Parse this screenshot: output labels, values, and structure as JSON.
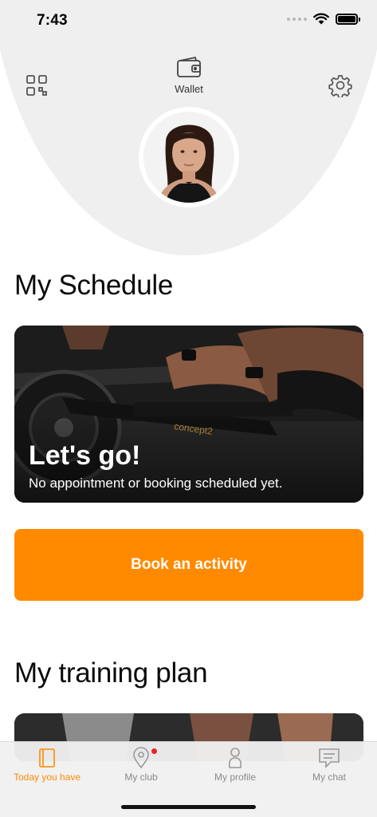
{
  "status_bar": {
    "time": "7:43"
  },
  "header": {
    "wallet_label": "Wallet"
  },
  "schedule": {
    "title": "My Schedule",
    "card_heading": "Let's go!",
    "card_text": "No appointment or booking scheduled yet."
  },
  "book_button": {
    "label": "Book an activity"
  },
  "training": {
    "title": "My training plan"
  },
  "tabs": [
    {
      "label": "Today you have",
      "active": true
    },
    {
      "label": "My club",
      "active": false
    },
    {
      "label": "My profile",
      "active": false
    },
    {
      "label": "My chat",
      "active": false
    }
  ],
  "colors": {
    "accent": "#ff8a00",
    "header_bg": "#efefef",
    "notification": "#e8232a"
  },
  "icons": [
    "qr-code-icon",
    "wallet-icon",
    "gear-icon",
    "signal-icon",
    "wifi-icon",
    "battery-icon",
    "book-icon",
    "location-pin-icon",
    "person-icon",
    "chat-icon"
  ]
}
